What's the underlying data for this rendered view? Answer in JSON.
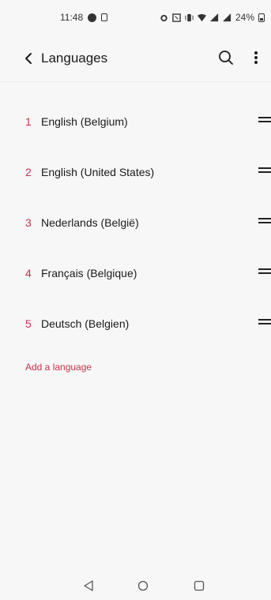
{
  "status_bar": {
    "time": "11:48",
    "battery": "24%",
    "icons": [
      "data-saver-icon",
      "lock-icon",
      "alarm-icon",
      "nfc-icon",
      "vibrate-icon",
      "wifi-icon",
      "signal-icon",
      "signal-icon",
      "battery-icon"
    ]
  },
  "toolbar": {
    "title": "Languages",
    "back_icon": "back-arrow-icon",
    "search_icon": "search-icon",
    "more_icon": "more-vert-icon"
  },
  "languages": [
    {
      "number": "1",
      "name": "English (Belgium)"
    },
    {
      "number": "2",
      "name": "English (United States)"
    },
    {
      "number": "3",
      "name": "Nederlands (België)"
    },
    {
      "number": "4",
      "name": "Français (Belgique)"
    },
    {
      "number": "5",
      "name": "Deutsch (Belgien)"
    }
  ],
  "add_language_label": "Add a language",
  "accent_color": "#c4314b",
  "nav_bar": {
    "icons": [
      "nav-back-icon",
      "nav-home-icon",
      "nav-recents-icon"
    ]
  }
}
